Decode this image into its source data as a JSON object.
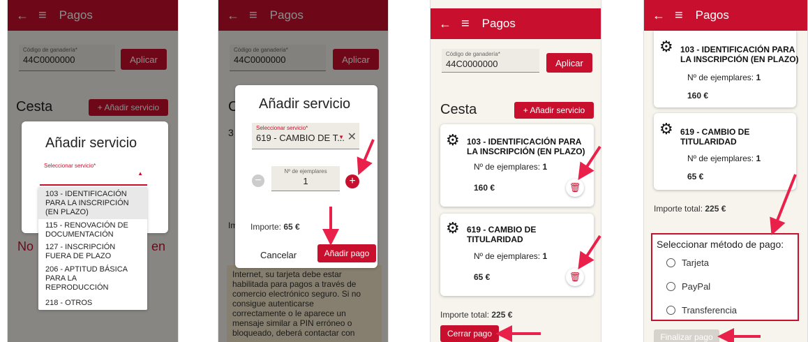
{
  "app_title": "Pagos",
  "herd_field": {
    "label": "Código de ganadería*",
    "value": "44C0000000"
  },
  "apply_button": "Aplicar",
  "cart_heading": "Cesta",
  "add_service_button": "+ Añadir servicio",
  "dialog": {
    "title": "Añadir servicio",
    "select_label": "Seleccionar servicio*",
    "selected_value": "619 - CAMBIO DE T...",
    "copies_label": "Nº de ejemplares",
    "copies_value": "1",
    "importe_label": "Importe:",
    "importe_value": "65 €",
    "cancel": "Cancelar",
    "confirm": "Añadir pago"
  },
  "service_options": [
    "103 - IDENTIFICACIÓN PARA LA INSCRIPCIÓN (EN PLAZO)",
    "115 - RENOVACIÓN DE DOCUMENTACIÓN",
    "127 - INSCRIPCIÓN FUERA DE PLAZO",
    "206 - APTITUD BÁSICA PARA LA REPRODUCCIÓN",
    "218 - OTROS"
  ],
  "bg_partial": {
    "no": "No",
    "en": "en",
    "im": "Im",
    "c": "C",
    "three": "3"
  },
  "items": [
    {
      "title": "103 - IDENTIFICACIÓN PARA LA INSCRIPCIÓN (EN PLAZO)",
      "copies_label": "Nº de ejemplares:",
      "copies": "1",
      "price": "160 €"
    },
    {
      "title": "619 - CAMBIO DE TITULARIDAD",
      "copies_label": "Nº de ejemplares:",
      "copies": "1",
      "price": "65 €"
    }
  ],
  "total_label": "Importe total:",
  "total_value": "225 €",
  "close_button": "Cerrar pago",
  "payment": {
    "heading": "Seleccionar método de pago:",
    "options": [
      "Tarjeta",
      "PayPal",
      "Transferencia"
    ]
  },
  "finish_button": "Finalizar pago",
  "warning_text": [
    "Internet, su tarjeta debe estar",
    "habilitada para pagos a través de",
    "comercio electrónico seguro. Si no",
    "consigue autenticarse",
    "correctamente o le aparece un",
    "mensaje similar a PIN erróneo o",
    "bloqueado, deberá contactar con"
  ],
  "colors": {
    "primary": "#c8102e",
    "arrow": "#e8204a"
  }
}
